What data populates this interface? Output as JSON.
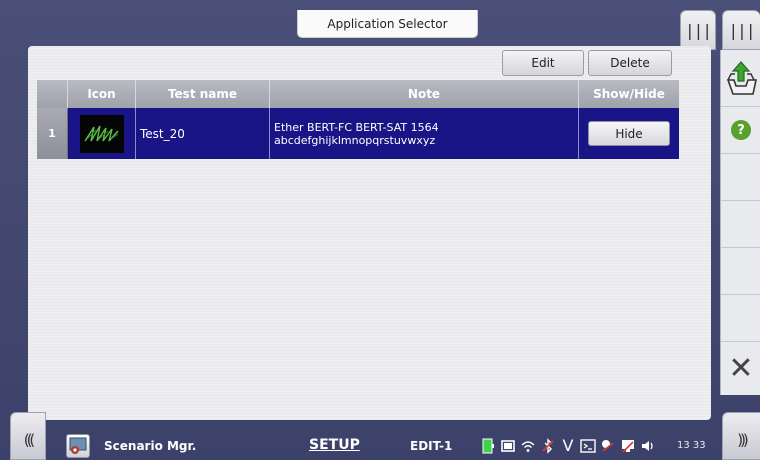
{
  "header": {
    "title": "Application Selector"
  },
  "toolbar": {
    "edit_label": "Edit",
    "delete_label": "Delete"
  },
  "table": {
    "columns": [
      "",
      "Icon",
      "Test name",
      "Note",
      "Show/Hide"
    ],
    "rows": [
      {
        "index": "1",
        "test_name": "Test_20",
        "note_line1": "Ether BERT-FC BERT-SAT 1564",
        "note_line2": "abcdefghijklmnopqrstuvwxyz",
        "action_label": "Hide"
      }
    ],
    "selected_row_color": "#1a1587"
  },
  "statusbar": {
    "app_name": "Scenario Mgr.",
    "mode": "SETUP",
    "edit_state": "EDIT-1",
    "clock": "13 33"
  },
  "icons": {
    "top_tabs": [
      "menu-bars-icon",
      "menu-bars-icon"
    ],
    "side": [
      "export-icon",
      "help-icon",
      "close-icon"
    ],
    "status": [
      "battery-icon",
      "screen-icon",
      "wifi-icon",
      "bluetooth-icon",
      "v-icon",
      "terminal-icon",
      "remote-icon",
      "network-icon",
      "volume-icon"
    ]
  }
}
